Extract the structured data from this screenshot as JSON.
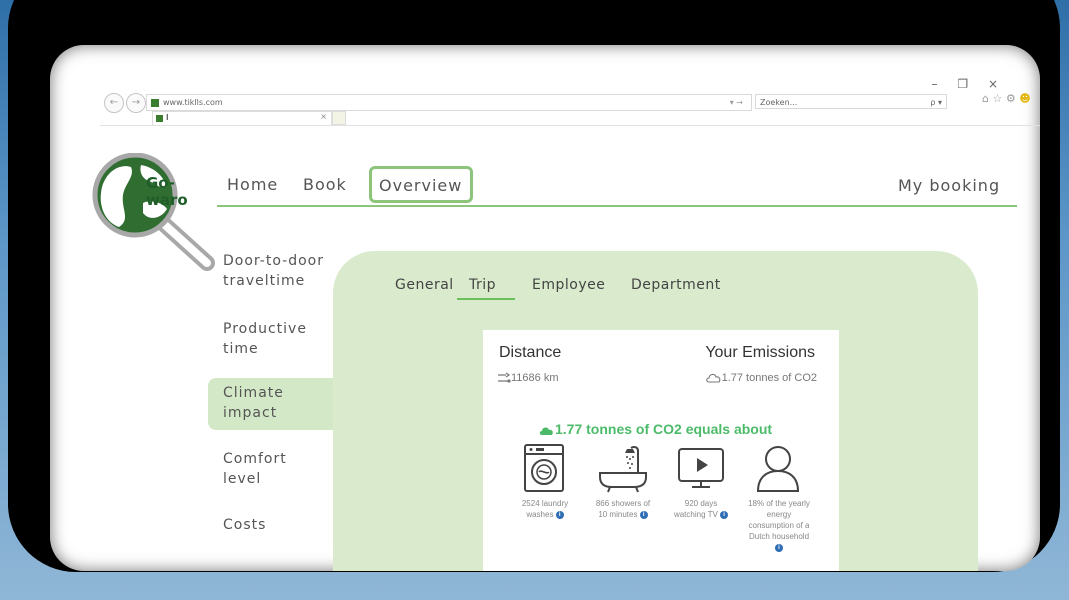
{
  "browser": {
    "url": "www.tiklls.com",
    "search_placeholder": "Zoeken...",
    "tab_title": "I",
    "window_controls": {
      "minimize": "–",
      "restore": "❐",
      "close": "×"
    },
    "go_arrow": "▾ →",
    "search_icon": "ρ ▾",
    "toolbar_icons": "⌂ ☆ ⚙",
    "smiley": "☻"
  },
  "logo": {
    "line1": "Go-",
    "line2": "waro"
  },
  "main_nav": {
    "home": "Home",
    "book": "Book",
    "overview": "Overview",
    "my_booking": "My booking"
  },
  "side_menu": [
    {
      "line1": "Door-to-door",
      "line2": "traveltime"
    },
    {
      "line1": "Productive",
      "line2": "time"
    },
    {
      "line1": "Climate",
      "line2": "impact"
    },
    {
      "line1": "Comfort",
      "line2": "level"
    },
    {
      "line1": "Costs",
      "line2": ""
    }
  ],
  "sub_tabs": {
    "general": "General",
    "trip": "Trip",
    "employee": "Employee",
    "department": "Department"
  },
  "card": {
    "distance_heading": "Distance",
    "distance_value": "11686 km",
    "emissions_heading": "Your Emissions",
    "emissions_value": "1.77 tonnes of CO2",
    "equals_title": "1.77 tonnes of CO2 equals about",
    "equivalents": [
      {
        "icon": "washing-machine-icon",
        "text": "2524 laundry washes"
      },
      {
        "icon": "shower-icon",
        "text": "866 showers of 10 minutes"
      },
      {
        "icon": "tv-icon",
        "text": "920 days watching TV"
      },
      {
        "icon": "person-icon",
        "text": "18% of the yearly energy consumption of a Dutch household"
      }
    ]
  },
  "colors": {
    "accent_green": "#8cc47a",
    "panel_green": "#d9ebcc",
    "highlight_green": "#4cbb69",
    "logo_green": "#1f5e28",
    "info_blue": "#2f6db5"
  }
}
